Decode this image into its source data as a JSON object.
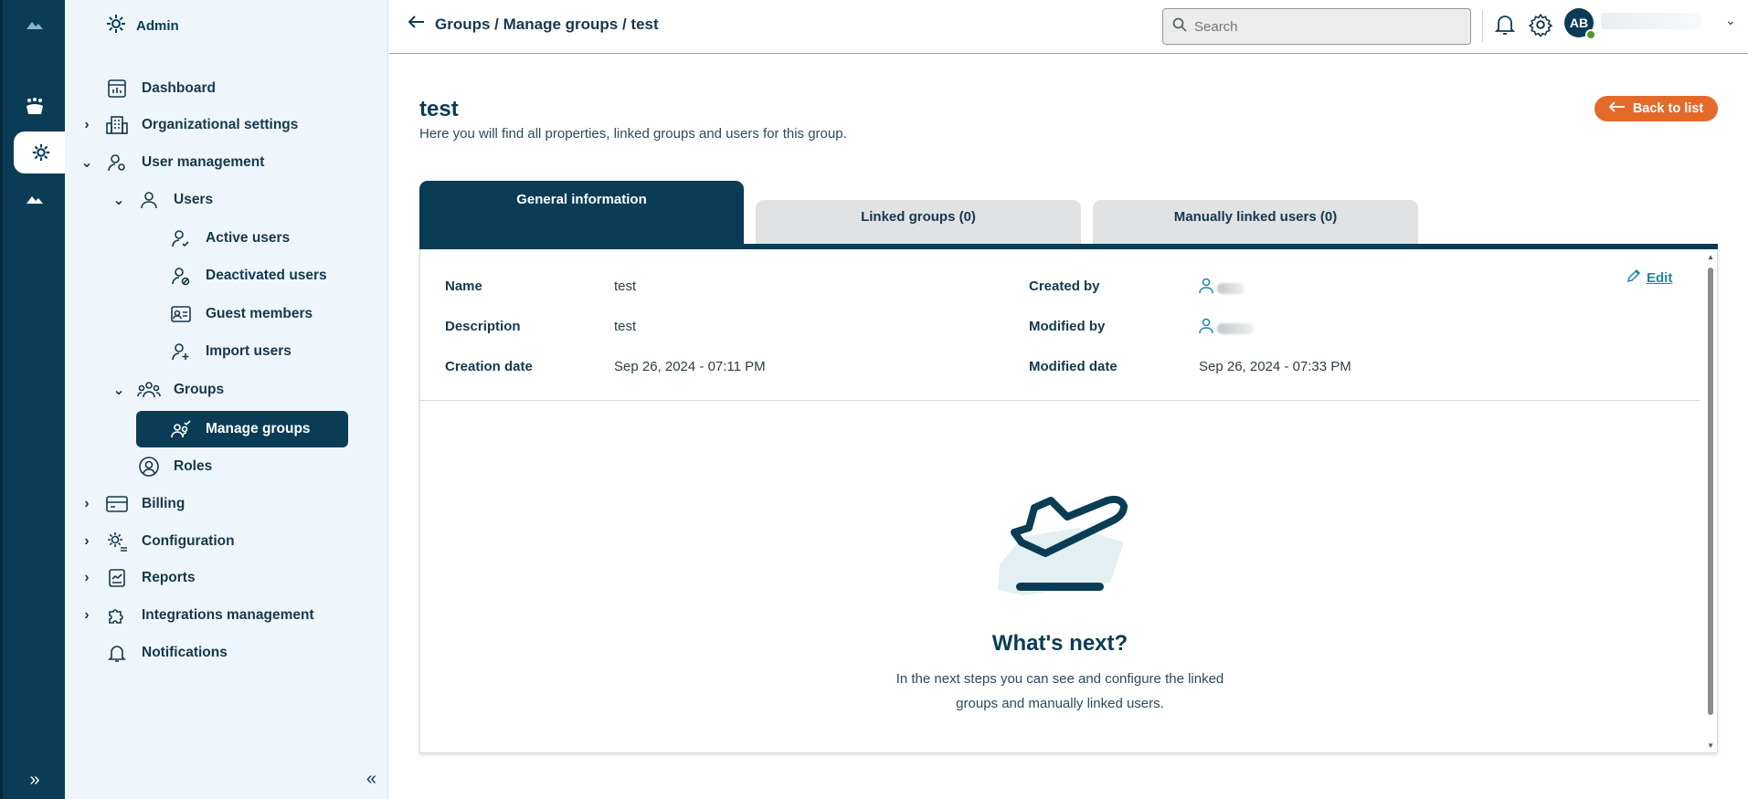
{
  "sidebar": {
    "header": "Admin",
    "items": [
      {
        "label": "Dashboard"
      },
      {
        "label": "Organizational settings"
      },
      {
        "label": "User management"
      },
      {
        "label": "Users"
      },
      {
        "label": "Active users"
      },
      {
        "label": "Deactivated users"
      },
      {
        "label": "Guest members"
      },
      {
        "label": "Import users"
      },
      {
        "label": "Groups"
      },
      {
        "label": "Manage groups"
      },
      {
        "label": "Roles"
      },
      {
        "label": "Billing"
      },
      {
        "label": "Configuration"
      },
      {
        "label": "Reports"
      },
      {
        "label": "Integrations management"
      },
      {
        "label": "Notifications"
      }
    ],
    "collapse_icon": "double-chevron-left-icon"
  },
  "header": {
    "breadcrumb": "Groups / Manage groups / test",
    "search_placeholder": "Search",
    "avatar_initials": "AB"
  },
  "main": {
    "title": "test",
    "subtitle": "Here you will find all properties, linked groups and users for this group.",
    "back_label": "Back to list",
    "tabs": [
      {
        "label": "General information",
        "active": true
      },
      {
        "label": "Linked groups (0)",
        "active": false
      },
      {
        "label": "Manually linked users (0)",
        "active": false
      }
    ],
    "edit_label": "Edit",
    "fields": {
      "name_label": "Name",
      "name_value": "test",
      "description_label": "Description",
      "description_value": "test",
      "creation_label": "Creation date",
      "creation_value": "Sep 26, 2024 - 07:11 PM",
      "created_by_label": "Created by",
      "modified_by_label": "Modified by",
      "modified_label": "Modified date",
      "modified_value": "Sep 26, 2024 - 07:33 PM"
    },
    "empty_state": {
      "title": "What's next?",
      "line1": "In the next steps you can see and configure the linked",
      "line2": "groups and manually linked users."
    }
  },
  "colors": {
    "primary": "#0a3c55",
    "accent": "#e36a2b",
    "link": "#1b86a8",
    "sidebar_bg": "#eef6fb"
  }
}
